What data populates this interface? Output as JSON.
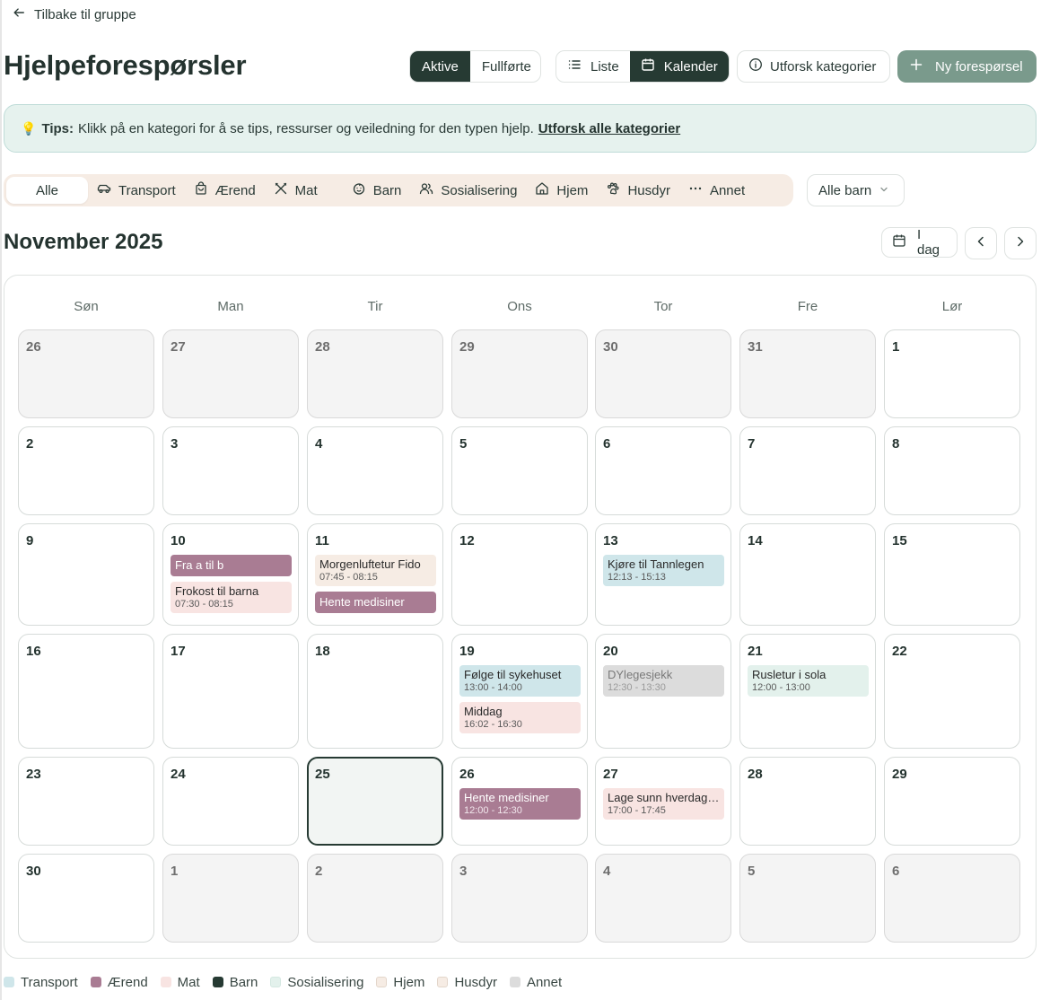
{
  "back_label": "Tilbake til gruppe",
  "page_title": "Hjelpeforespørsler",
  "status_tabs": [
    {
      "label": "Aktive",
      "active": true
    },
    {
      "label": "Fullførte",
      "active": false
    }
  ],
  "view_tabs": [
    {
      "label": "Liste",
      "icon": "list-icon",
      "active": false
    },
    {
      "label": "Kalender",
      "icon": "calendar-icon",
      "active": true
    }
  ],
  "explore_button": "Utforsk kategorier",
  "new_request_button": "Ny forespørsel",
  "tips": {
    "bold": "Tips:",
    "text": "Klikk på en kategori for å se tips, ressurser og veiledning for den typen hjelp.",
    "link": "Utforsk alle kategorier"
  },
  "categories": [
    {
      "label": "Alle",
      "icon": "",
      "active": true
    },
    {
      "label": "Transport",
      "icon": "car-icon"
    },
    {
      "label": "Ærend",
      "icon": "shopping-bag-icon"
    },
    {
      "label": "Mat",
      "icon": "utensils-icon"
    },
    {
      "label": "Barn",
      "icon": "baby-icon"
    },
    {
      "label": "Sosialisering",
      "icon": "users-icon"
    },
    {
      "label": "Hjem",
      "icon": "home-icon"
    },
    {
      "label": "Husdyr",
      "icon": "paw-icon"
    },
    {
      "label": "Annet",
      "icon": "more-icon"
    }
  ],
  "child_filter": "Alle barn",
  "month_title": "November 2025",
  "today_button": "I dag",
  "weekdays": [
    "Søn",
    "Man",
    "Tir",
    "Ons",
    "Tor",
    "Fre",
    "Lør"
  ],
  "colors": {
    "transport": "#cfe6ea",
    "aerend": "#a97c93",
    "mat": "#f8e4e2",
    "barn": "#263a33",
    "sosialisering": "#e3f1ec",
    "hjem": "#f6ece4",
    "husdyr": "#f6ece4",
    "annet": "#dcdcdc"
  },
  "weeks": [
    [
      {
        "day": "26",
        "other": true
      },
      {
        "day": "27",
        "other": true
      },
      {
        "day": "28",
        "other": true
      },
      {
        "day": "29",
        "other": true
      },
      {
        "day": "30",
        "other": true
      },
      {
        "day": "31",
        "other": true
      },
      {
        "day": "1"
      }
    ],
    [
      {
        "day": "2"
      },
      {
        "day": "3"
      },
      {
        "day": "4"
      },
      {
        "day": "5"
      },
      {
        "day": "6"
      },
      {
        "day": "7"
      },
      {
        "day": "8"
      }
    ],
    [
      {
        "day": "9"
      },
      {
        "day": "10",
        "events": [
          {
            "title": "Fra a til b",
            "time": "",
            "cat": "aerend"
          },
          {
            "title": "Frokost til barna",
            "time": "07:30 - 08:15",
            "cat": "mat"
          }
        ]
      },
      {
        "day": "11",
        "events": [
          {
            "title": "Morgenluftetur Fido",
            "time": "07:45 - 08:15",
            "cat": "husdyr"
          },
          {
            "title": "Hente medisiner",
            "time": "",
            "cat": "aerend"
          }
        ]
      },
      {
        "day": "12"
      },
      {
        "day": "13",
        "events": [
          {
            "title": "Kjøre til Tannlegen",
            "time": "12:13 - 15:13",
            "cat": "transport"
          }
        ]
      },
      {
        "day": "14"
      },
      {
        "day": "15"
      }
    ],
    [
      {
        "day": "16"
      },
      {
        "day": "17"
      },
      {
        "day": "18"
      },
      {
        "day": "19",
        "events": [
          {
            "title": "Følge til sykehuset",
            "time": "13:00 - 14:00",
            "cat": "transport"
          },
          {
            "title": "Middag",
            "time": "16:02 - 16:30",
            "cat": "mat"
          }
        ]
      },
      {
        "day": "20",
        "events": [
          {
            "title": "DYlegesjekk",
            "time": "12:30 - 13:30",
            "cat": "annet"
          }
        ]
      },
      {
        "day": "21",
        "events": [
          {
            "title": "Rusletur i sola",
            "time": "12:00 - 13:00",
            "cat": "sosialisering"
          }
        ]
      },
      {
        "day": "22"
      }
    ],
    [
      {
        "day": "23"
      },
      {
        "day": "24"
      },
      {
        "day": "25",
        "today": true
      },
      {
        "day": "26",
        "events": [
          {
            "title": "Hente medisiner",
            "time": "12:00 - 12:30",
            "cat": "aerend"
          }
        ]
      },
      {
        "day": "27",
        "events": [
          {
            "title": "Lage sunn hverdags...",
            "time": "17:00 - 17:45",
            "cat": "mat"
          }
        ]
      },
      {
        "day": "28"
      },
      {
        "day": "29"
      }
    ],
    [
      {
        "day": "30"
      },
      {
        "day": "1",
        "other": true
      },
      {
        "day": "2",
        "other": true
      },
      {
        "day": "3",
        "other": true
      },
      {
        "day": "4",
        "other": true
      },
      {
        "day": "5",
        "other": true
      },
      {
        "day": "6",
        "other": true
      }
    ]
  ],
  "legend": [
    {
      "label": "Transport",
      "cat": "transport"
    },
    {
      "label": "Ærend",
      "cat": "aerend"
    },
    {
      "label": "Mat",
      "cat": "mat"
    },
    {
      "label": "Barn",
      "cat": "barn"
    },
    {
      "label": "Sosialisering",
      "cat": "sosialisering"
    },
    {
      "label": "Hjem",
      "cat": "hjem"
    },
    {
      "label": "Husdyr",
      "cat": "husdyr"
    },
    {
      "label": "Annet",
      "cat": "annet"
    }
  ]
}
